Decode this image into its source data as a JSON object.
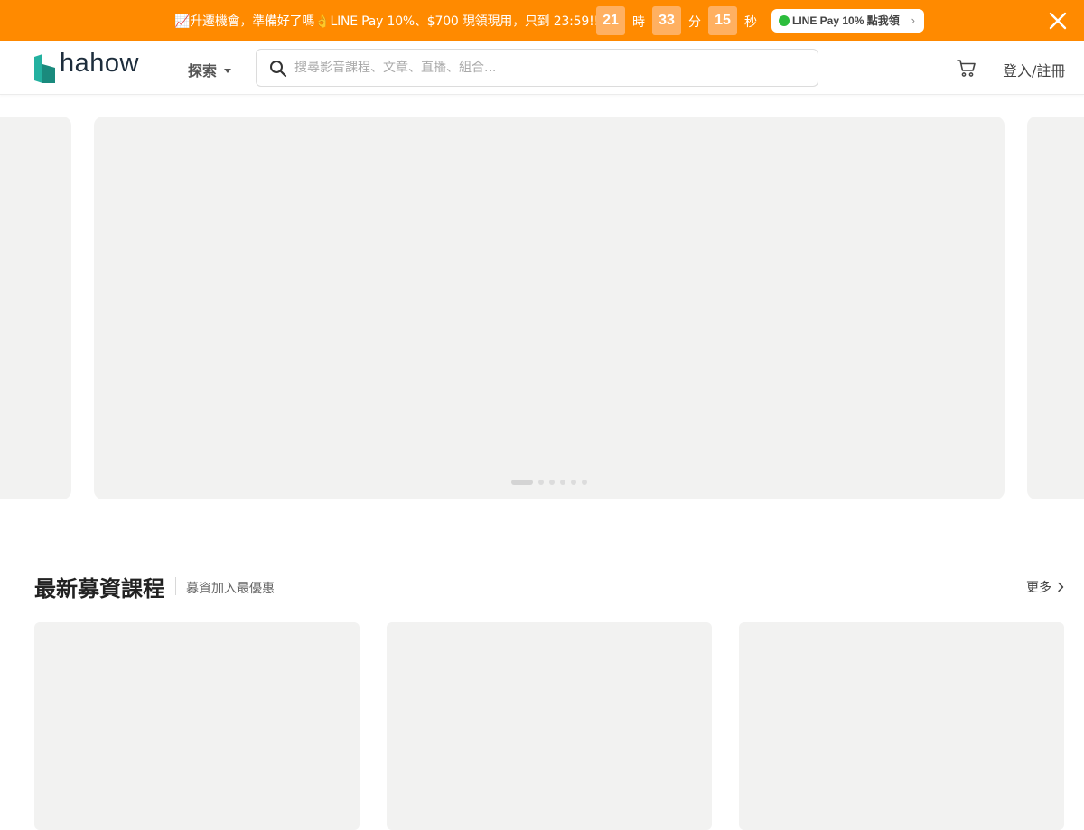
{
  "promo": {
    "text": "📈升遷機會，準備好了嗎👌LINE Pay 10%、$700 現領現用，只到 23:59!!",
    "countdown": [
      {
        "value": "21",
        "unit": "時"
      },
      {
        "value": "33",
        "unit": "分"
      },
      {
        "value": "15",
        "unit": "秒"
      }
    ],
    "cta_label": "LINE Pay 10% 點我領",
    "close_icon": "close-icon",
    "color": "#ff8a00"
  },
  "header": {
    "logo_text": "hahow",
    "explore_label": "探索",
    "search_placeholder": "搜尋影音課程、文章、直播、組合...",
    "cart_icon": "cart-icon",
    "login_label": "登入/註冊"
  },
  "carousel": {
    "slide_count": 6,
    "active_index": 0
  },
  "section": {
    "title": "最新募資課程",
    "subtitle": "募資加入最優惠",
    "more_label": "更多"
  },
  "colors": {
    "brand_teal": "#23b1a0",
    "placeholder_gray": "#f2f2f1"
  }
}
